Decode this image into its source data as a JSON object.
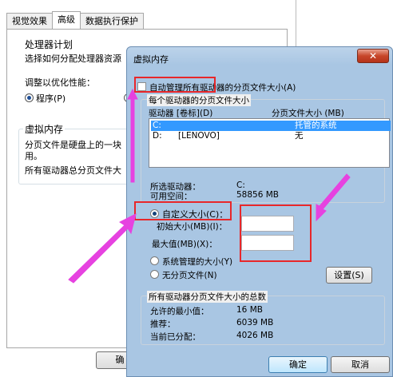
{
  "background": {
    "tabs": [
      "视觉效果",
      "高级",
      "数据执行保护"
    ],
    "active_tab": 1,
    "processor_group_title": "处理器计划",
    "processor_desc": "选择如何分配处理器资源",
    "adjust_label": "调整以优化性能：",
    "program_option": "程序(P)",
    "vm_group_title": "虚拟内存",
    "vm_desc_line1": "分页文件是硬盘上的一块",
    "vm_desc_line2": "用。",
    "vm_desc_line3": "所有驱动器总分页文件大",
    "ok_label": "确"
  },
  "dialog": {
    "title": "虚拟内存",
    "close_glyph": "✕",
    "auto_manage_label": "自动管理所有驱动器的分页文件大小(A)",
    "per_drive_title": "每个驱动器的分页文件大小",
    "col_drive": "驱动器 [卷标](D)",
    "col_size": "分页文件大小 (MB)",
    "drives": [
      {
        "drive": "C:",
        "label": "",
        "size": "托管的系统"
      },
      {
        "drive": "D:",
        "label": "[LENOVO]",
        "size": "无"
      }
    ],
    "selected_drive_label": "所选驱动器：",
    "selected_drive_value": "C:",
    "available_label": "可用空间：",
    "available_value": "58856 MB",
    "custom_size_label": "自定义大小(C)：",
    "initial_size_label": "初始大小(MB)(I)：",
    "max_size_label": "最大值(MB)(X)：",
    "system_managed_label": "系统管理的大小(Y)",
    "no_paging_label": "无分页文件(N)",
    "set_button": "设置(S)",
    "total_title": "所有驱动器分页文件大小的总数",
    "min_allowed_label": "允许的最小值：",
    "min_allowed_value": "16 MB",
    "recommended_label": "推荐：",
    "recommended_value": "6039 MB",
    "current_label": "当前已分配：",
    "current_value": "4026 MB",
    "ok_button": "确定",
    "cancel_button": "取消"
  },
  "colors": {
    "annotation_red": "#e8272a",
    "annotation_magenta": "#e642e0",
    "selection_blue": "#3399ff"
  }
}
